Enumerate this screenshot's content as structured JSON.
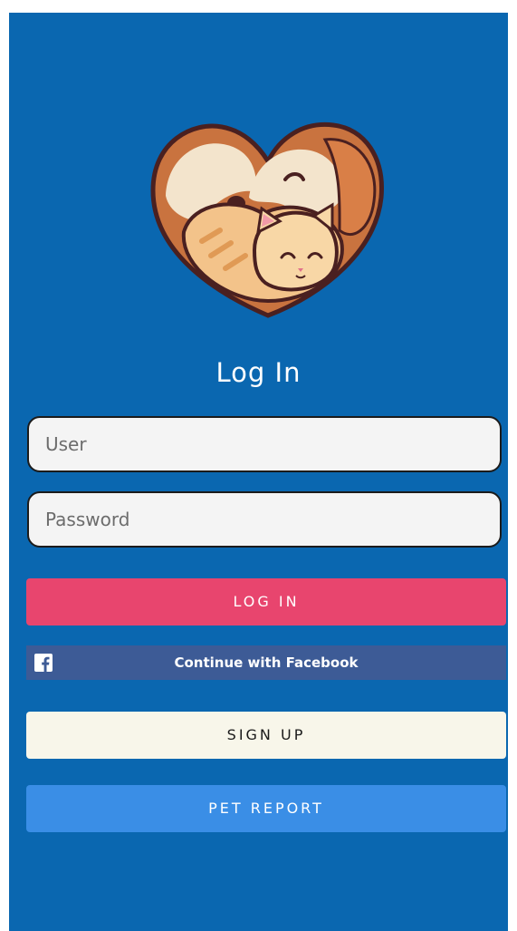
{
  "app": {
    "title": "Log In"
  },
  "form": {
    "user_placeholder": "User",
    "password_placeholder": "Password"
  },
  "buttons": {
    "login_label": "LOG IN",
    "facebook_label": "Continue with Facebook",
    "signup_label": "SIGN UP",
    "pet_report_label": "PET REPORT"
  },
  "icons": {
    "logo": "dog-and-cat-heart-logo",
    "facebook": "facebook-icon"
  },
  "colors": {
    "background": "#0a67b0",
    "login_button": "#e8456e",
    "facebook_button": "#3d5b96",
    "signup_button": "#f8f6ea",
    "pet_report_button": "#3a8ee6"
  }
}
